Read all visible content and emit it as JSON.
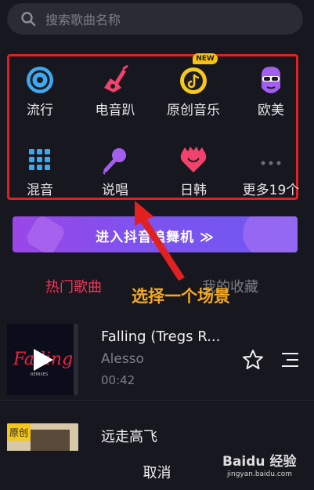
{
  "search": {
    "placeholder": "搜索歌曲名称",
    "icon": "search-icon"
  },
  "categories": [
    {
      "label": "流行",
      "icon": "vinyl-icon"
    },
    {
      "label": "电音趴",
      "icon": "guitar-icon"
    },
    {
      "label": "原创音乐",
      "icon": "tiktok-note-icon",
      "badge": "NEW"
    },
    {
      "label": "欧美",
      "icon": "sunglasses-face-icon"
    },
    {
      "label": "混音",
      "icon": "grid-dots-icon"
    },
    {
      "label": "说唱",
      "icon": "microphone-icon"
    },
    {
      "label": "日韩",
      "icon": "heart-hair-icon"
    },
    {
      "label": "更多19个",
      "icon": "more-dots-icon"
    }
  ],
  "banner": {
    "label": "进入抖音追舞机 ≫"
  },
  "tabs": {
    "hot": "热门歌曲",
    "favorites": "我的收藏"
  },
  "annotation": "选择一个场景",
  "songs": [
    {
      "title": "Falling (Tregs R...",
      "artist": "Alesso",
      "duration": "00:42",
      "cover_text": "Falling",
      "cover_sub": "REMIXES"
    },
    {
      "title": "远走高飞",
      "cover_badge": "原创"
    }
  ],
  "footer": {
    "cancel": "取消"
  },
  "watermark": {
    "line1": "Baidu 经验",
    "line2": "jingyan.baidu.com"
  },
  "colors": {
    "background": "#17171f",
    "accent_red": "#f2365a",
    "annotation_orange": "#f6a91b",
    "highlight_box": "#e32020",
    "banner_purple": "#8a4cec"
  }
}
